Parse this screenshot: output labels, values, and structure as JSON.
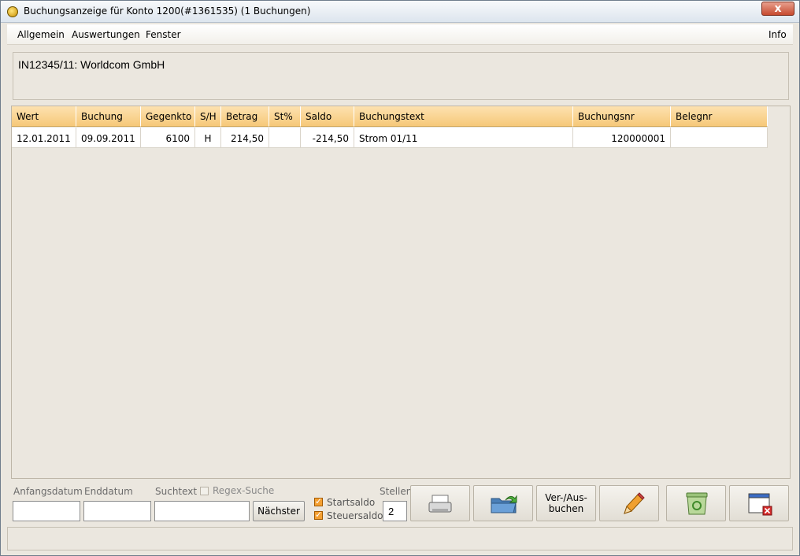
{
  "window": {
    "title": "Buchungsanzeige für Konto 1200(#1361535) (1 Buchungen)",
    "close_label": "x"
  },
  "menu": {
    "allgemein": "Allgemein",
    "auswertungen": "Auswertungen",
    "fenster": "Fenster",
    "info": "Info"
  },
  "account": {
    "label": "IN12345/11: Worldcom GmbH"
  },
  "table": {
    "columns": [
      "Wert",
      "Buchung",
      "Gegenkto",
      "S/H",
      "Betrag",
      "St%",
      "Saldo",
      "Buchungstext",
      "Buchungsnr",
      "Belegnr"
    ],
    "rows": [
      [
        "12.01.2011",
        "09.09.2011",
        "6100",
        "H",
        "214,50",
        "",
        "-214,50",
        "Strom 01/11",
        "120000001",
        ""
      ]
    ]
  },
  "filters": {
    "anfangsdatum_label": "Anfangsdatum",
    "enddatum_label": "Enddatum",
    "suchtext_label": "Suchtext",
    "regex_label": "Regex-Suche",
    "naechster_label": "Nächster",
    "startsaldo_label": "Startsaldo",
    "steuersaldo_label": "Steuersaldo",
    "stellen_label": "Stellen",
    "stellen_value": "2",
    "anfangsdatum_value": "",
    "enddatum_value": "",
    "suchtext_value": ""
  },
  "buttons": {
    "verbuchen_line1": "Ver-/Aus-",
    "verbuchen_line2": "buchen"
  },
  "icons": [
    "app-icon",
    "close-icon",
    "print-icon",
    "export-folder-icon",
    "pencil-icon",
    "recycle-bin-icon",
    "close-window-icon"
  ]
}
